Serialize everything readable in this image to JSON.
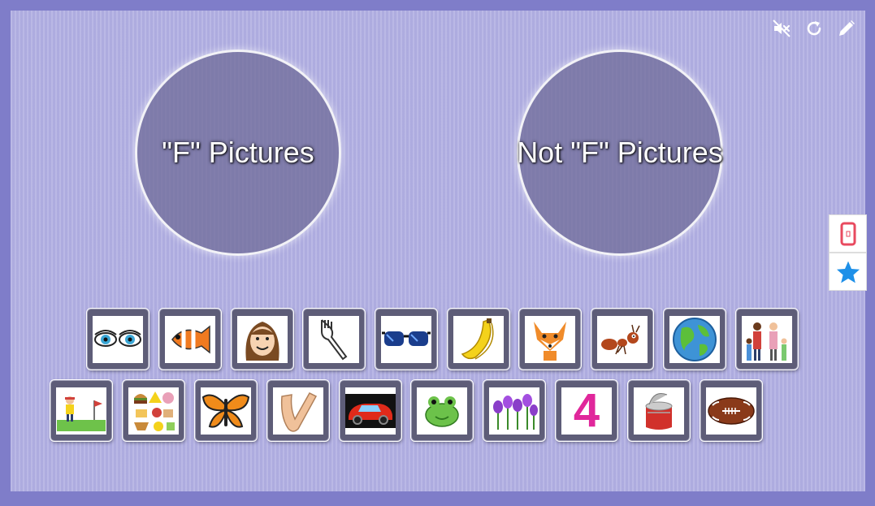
{
  "categories": {
    "left_label": "\"F\" Pictures",
    "right_label": "Not \"F\" Pictures"
  },
  "top_icons": [
    "mute-icon",
    "refresh-icon",
    "pencil-icon"
  ],
  "side_buttons": [
    "phone-icon",
    "star-icon"
  ],
  "cards_row1": [
    "eyes",
    "fish",
    "face",
    "fork",
    "glasses",
    "bananas",
    "fox",
    "ant",
    "earth",
    "family"
  ],
  "cards_row2": [
    "golf",
    "food",
    "butterfly",
    "elbow",
    "car",
    "frog",
    "flowers",
    "four",
    "can",
    "football"
  ],
  "four_digit": "4",
  "colors": {
    "background": "#b2b0e2",
    "border": "#7f7dc9",
    "card": "#5e5d78",
    "star": "#1e90e8",
    "phone": "#e84a5f"
  }
}
